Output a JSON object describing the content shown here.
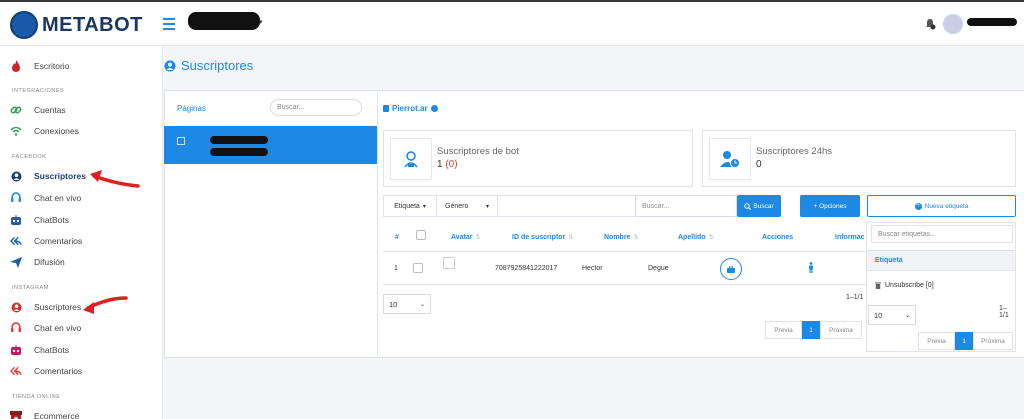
{
  "app": {
    "logo_text": "METABOT"
  },
  "sidebar": {
    "sections": {
      "integraciones": "INTEGRACIONES",
      "facebook": "FACEBOOK",
      "instagram": "INSTAGRAM",
      "tienda": "TIENDA ONLINE"
    },
    "items": {
      "escritorio": "Escritorio",
      "cuentas": "Cuentas",
      "conexiones": "Conexiones",
      "fb_suscriptores": "Suscriptores",
      "fb_chat": "Chat en vivo",
      "fb_chatbots": "ChatBots",
      "fb_comentarios": "Comentarios",
      "fb_difusion": "Difusión",
      "ig_suscriptores": "Suscriptores",
      "ig_chat": "Chat en vivo",
      "ig_chatbots": "ChatBots",
      "ig_comentarios": "Comentarios",
      "ecommerce": "Ecommerce"
    }
  },
  "main": {
    "title": "Suscriptores",
    "pages": {
      "label": "Páginas",
      "search_placeholder": "Buscar..."
    },
    "page_name": "Pierrot.ar",
    "stats": {
      "bot": {
        "label": "Suscriptores de bot",
        "value": "1",
        "extra": "(0)"
      },
      "day": {
        "label": "Suscriptores 24hs",
        "value": "0"
      }
    },
    "filters": {
      "etiqueta": "Etiqueta",
      "genero": "Género",
      "search_placeholder": "Buscar...",
      "search_button": "Buscar",
      "options_button": "+ Opciones",
      "new_tag_button": "Nueva etiqueta"
    },
    "table": {
      "headers": [
        "#",
        "Avatar",
        "ID de suscriptor",
        "Nombre",
        "Apellido",
        "Acciones",
        "Informac"
      ],
      "rows": [
        {
          "num": "1",
          "id": "7087925841222017",
          "nombre": "Hector",
          "apellido": "Degue"
        }
      ],
      "page_size": "10",
      "count": "1–1/1",
      "prev": "Previa",
      "page": "1",
      "next": "Próxima"
    },
    "tag_panel": {
      "search_placeholder": "Buscar etiquetas...",
      "header": "Etiqueta",
      "items": [
        "Unsubscribe [0]"
      ],
      "page_size": "10",
      "count": "1–1/1",
      "prev": "Previa",
      "page": "1",
      "next": "Próxima"
    }
  },
  "colors": {
    "accent": "#1e88e5",
    "active_row": "#1e88e5",
    "annotation_arrow": "#e02020",
    "danger": "#e53935"
  }
}
